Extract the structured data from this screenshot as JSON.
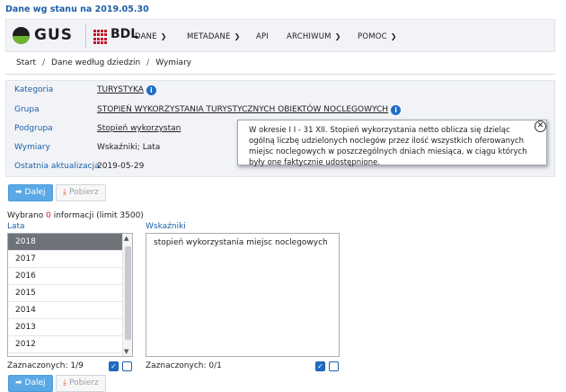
{
  "header": {
    "state_label": "Dane wg stanu na 2019.05.30"
  },
  "logos": {
    "gus": "GUS",
    "bdl": "BDL"
  },
  "menu": [
    {
      "label": "DANE",
      "has_dropdown": true
    },
    {
      "label": "METADANE",
      "has_dropdown": true
    },
    {
      "label": "API",
      "has_dropdown": false
    },
    {
      "label": "ARCHIWUM",
      "has_dropdown": true
    },
    {
      "label": "POMOC",
      "has_dropdown": true
    }
  ],
  "breadcrumb": [
    "Start",
    "Dane według dziedzin",
    "Wymiary"
  ],
  "info": {
    "kategoria": {
      "label": "Kategoria",
      "value": "TURYSTYKA"
    },
    "grupa": {
      "label": "Grupa",
      "value": "STOPIEŃ WYKORZYSTANIA TURYSTYCZNYCH OBIEKTÓW NOCLEGOWYCH"
    },
    "podgrupa": {
      "label": "Podgrupa",
      "value": "Stopień wykorzystan"
    },
    "wymiary": {
      "label": "Wymiary",
      "value": "Wskaźniki; Lata"
    },
    "aktualizacja": {
      "label": "Ostatnia aktualizacja",
      "value": "2019-05-29"
    }
  },
  "tooltip": {
    "text": "W okresie I I - 31 XII. Stopień wykorzystania netto oblicza się dzieląc ogólną liczbę udzielonych noclegów przez ilość wszystkich oferowanych miejsc noclegowych w poszczególnych dniach miesiąca, w ciągu których były one faktycznie udostępnione.",
    "close_icon": "close-circle-icon"
  },
  "buttons": {
    "next": "Dalej",
    "download": "Pobierz"
  },
  "selection": {
    "prefix": "Wybrano",
    "count": "0",
    "suffix": "informacji (limit 3500)"
  },
  "lata": {
    "title": "Lata",
    "items": [
      "2018",
      "2017",
      "2016",
      "2015",
      "2014",
      "2013",
      "2012",
      "2011"
    ],
    "selected": "2018",
    "count_label": "Zaznaczonych: 1/9"
  },
  "wskazniki": {
    "title": "Wskaźniki",
    "items": [
      "stopień wykorzystania miejsc noclegowych"
    ],
    "count_label": "Zaznaczonych: 0/1"
  },
  "colors": {
    "accent": "#1d5fa8",
    "button": "#5aa9e6",
    "selected_row": "#6e7279",
    "selection_count": "#d21e1e"
  }
}
